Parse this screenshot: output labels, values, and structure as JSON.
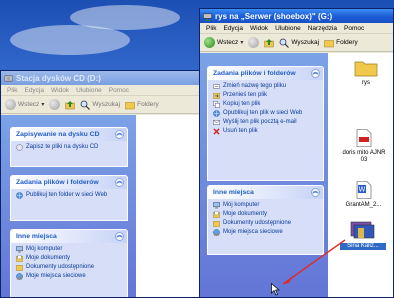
{
  "back_window": {
    "title": "Stacja dysków CD (D:)",
    "menu": [
      "Plik",
      "Edycja",
      "Widok",
      "Ulubione",
      "Pomoc"
    ],
    "toolbar": {
      "back": "Wstecz",
      "search": "Wyszukaj",
      "folders": "Foldery"
    },
    "tasks": [
      {
        "header": "Zapisywanie na dysku CD",
        "items": [
          {
            "label": "Zapisz te pliki na dysku CD",
            "icon": "cd-write-icon"
          }
        ]
      },
      {
        "header": "Zadania plików i folderów",
        "items": [
          {
            "label": "Publikuj ten folder w sieci Web",
            "icon": "web-publish-icon"
          }
        ]
      },
      {
        "header": "Inne miejsca",
        "items": [
          {
            "label": "Mój komputer",
            "icon": "computer-icon"
          },
          {
            "label": "Moje dokumenty",
            "icon": "documents-icon"
          },
          {
            "label": "Dokumenty udostępnione",
            "icon": "shared-folder-icon"
          },
          {
            "label": "Moje miejsca sieciowe",
            "icon": "network-icon"
          }
        ]
      }
    ]
  },
  "front_window": {
    "title": "rys na „Serwer (shoebox)\" (G:)",
    "menu": [
      "Plik",
      "Edycja",
      "Widok",
      "Ulubione",
      "Narzędzia",
      "Pomoc"
    ],
    "toolbar": {
      "back": "Wstecz",
      "search": "Wyszukaj",
      "folders": "Foldery"
    },
    "tasks": [
      {
        "header": "Zadania plików i folderów",
        "items": [
          {
            "label": "Zmień nazwę tego pliku",
            "icon": "rename-icon"
          },
          {
            "label": "Przenieś ten plik",
            "icon": "move-icon"
          },
          {
            "label": "Kopiuj ten plik",
            "icon": "copy-icon"
          },
          {
            "label": "Opublikuj ten plik w sieci Web",
            "icon": "web-publish-icon"
          },
          {
            "label": "Wyślij ten plik pocztą e-mail",
            "icon": "email-icon"
          },
          {
            "label": "Usuń ten plik",
            "icon": "delete-icon"
          }
        ]
      },
      {
        "header": "Inne miejsca",
        "items": [
          {
            "label": "Mój komputer",
            "icon": "computer-icon"
          },
          {
            "label": "Moje dokumenty",
            "icon": "documents-icon"
          },
          {
            "label": "Dokumenty udostępnione",
            "icon": "shared-folder-icon"
          },
          {
            "label": "Moje miejsca sieciowe",
            "icon": "network-icon"
          }
        ]
      }
    ],
    "files": [
      {
        "name": "rys",
        "type": "folder"
      },
      {
        "name": "doris mito AJNR 03",
        "type": "pdf"
      },
      {
        "name": "GrantAM_2...",
        "type": "word"
      },
      {
        "name": "Sina Kaliz...",
        "type": "archive",
        "selected": true
      }
    ]
  },
  "colors": {
    "task_link": "#0c3a9c",
    "task_header": "#215dc6",
    "drag_arrow": "#e02a2a"
  }
}
